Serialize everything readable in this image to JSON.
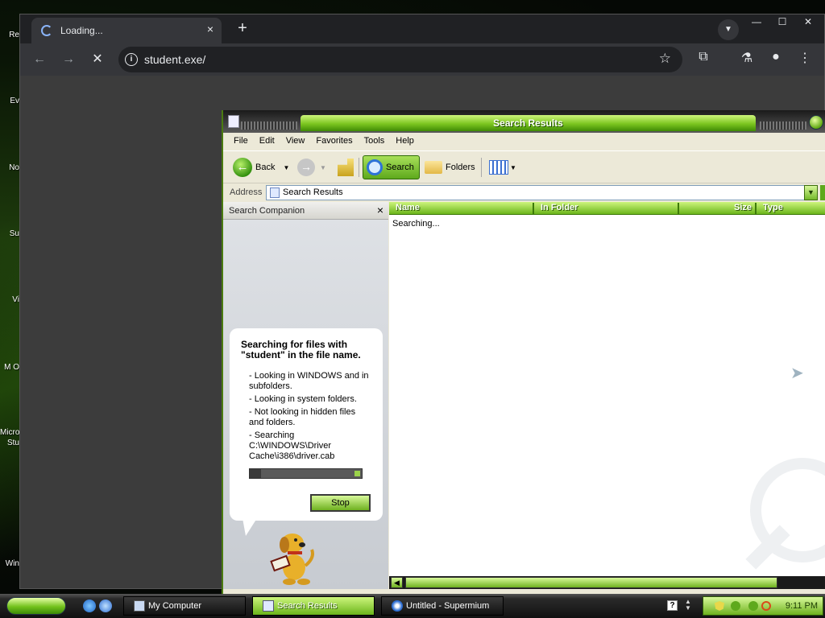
{
  "desktop": {
    "icons": [
      "Re",
      "Ev",
      "No",
      "Su",
      "Vi",
      "M O",
      "Micro Stu",
      "Win"
    ]
  },
  "browser": {
    "tab_title": "Loading...",
    "url": "student.exe/",
    "new_tab": "+",
    "tab_close": "×",
    "window_controls": {
      "minimize": "—",
      "maximize": "☐",
      "close": "✕"
    },
    "nav": {
      "back": "←",
      "forward": "→",
      "stop": "✕"
    }
  },
  "explorer": {
    "title": "Search Results",
    "menu": [
      "File",
      "Edit",
      "View",
      "Favorites",
      "Tools",
      "Help"
    ],
    "toolbar": {
      "back_label": "Back",
      "search_label": "Search",
      "folders_label": "Folders"
    },
    "address": {
      "label": "Address",
      "value": "Search Results"
    },
    "companion": {
      "header": "Search Companion",
      "close": "×",
      "heading": "Searching for files with \"student\" in the file name.",
      "items": [
        "- Looking in WINDOWS and in subfolders.",
        "- Looking in system folders.",
        "- Not looking in hidden files and folders.",
        "- Searching C:\\WINDOWS\\Driver Cache\\i386\\driver.cab"
      ],
      "progress": 0.1,
      "stop_label": "Stop"
    },
    "results": {
      "columns": [
        "Name",
        "In Folder",
        "Size",
        "Type"
      ],
      "status": "Searching..."
    }
  },
  "taskbar": {
    "buttons": [
      {
        "label": "My Computer",
        "active": false
      },
      {
        "label": "Search Results",
        "active": true
      },
      {
        "label": "Untitled - Supermium",
        "active": false
      }
    ],
    "clock": "9:11 PM",
    "help": "?"
  },
  "colors": {
    "accent_green": "#7bc51f",
    "dark_green": "#3d7a09",
    "browser_bg": "#3c3c3c"
  }
}
